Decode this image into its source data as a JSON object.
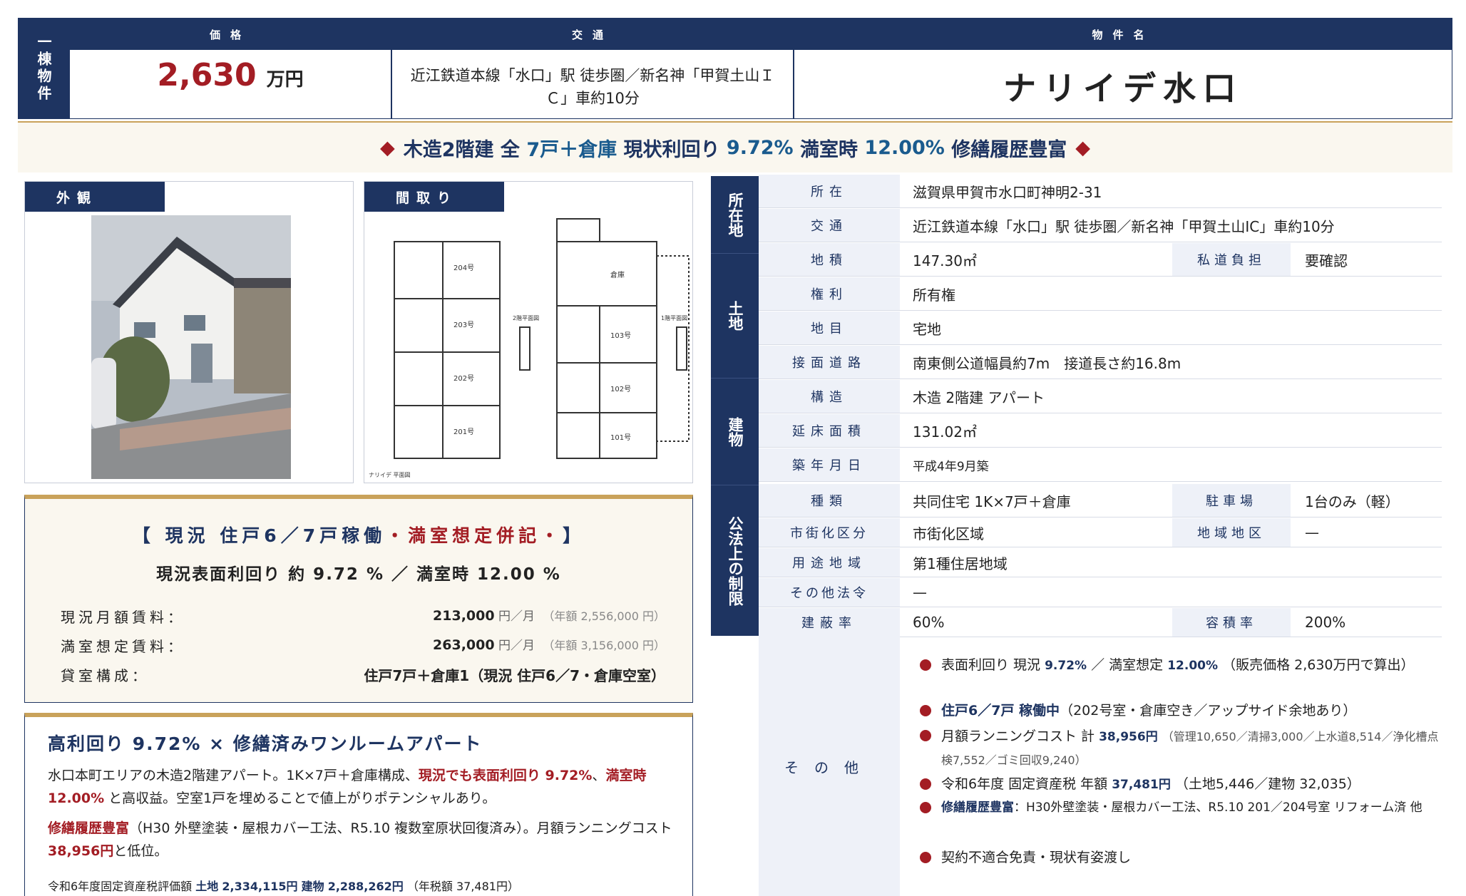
{
  "header": {
    "side_label": "一棟物件",
    "price_label": "価格",
    "price_value": "2,630",
    "price_unit": "万円",
    "transport_label": "交通",
    "transport_value": "近江鉄道本線「水口」駅 徒歩圏／新名神「甲賀土山ＩＣ」車約10分",
    "name_label": "物件名",
    "name_value": "ナリイデ水口"
  },
  "banner": {
    "diamond": "◆",
    "pre": "木造2階建 全",
    "hl1": "7戸＋倉庫",
    "mid": "現状利回り",
    "hl2": "9.72%",
    "mid2": "満室時",
    "hl3": "12.00%",
    "post": "修繕履歴豊富"
  },
  "photos": {
    "exterior_label": "外観",
    "floorplan_label": "間取り",
    "floorplan_rooms": [
      "204号",
      "203号",
      "202号",
      "201号",
      "倉庫",
      "103号",
      "102号",
      "101号"
    ],
    "floorplan_side_labels": [
      "2階平面図",
      "1階平面図"
    ],
    "floorplan_caption": "ナリイデ 平面図"
  },
  "income": {
    "title_open": "【",
    "title_main": "現況 住戸6／7戸稼働",
    "title_red": "・満室想定併記・",
    "title_close": "】",
    "subtitle": "現況表面利回り 約 9.72 % ／ 満室時 12.00 %",
    "rows": [
      {
        "label": "現況月額賃料：",
        "amount": "213,000",
        "unit": "円／月",
        "note": "（年額 2,556,000 円）"
      },
      {
        "label": "満室想定賃料：",
        "amount": "263,000",
        "unit": "円／月",
        "note": "（年額 3,156,000 円）"
      },
      {
        "label": "貸室構成：",
        "amount": "住戸7戸＋倉庫1（現況 住戸6／7・倉庫空室）",
        "unit": "",
        "note": ""
      }
    ]
  },
  "feature": {
    "title": "高利回り 9.72% × 修繕済みワンルームアパート",
    "p1_a": "水口本町エリアの木造2階建アパート。1K×7戸＋倉庫構成、",
    "p1_red1": "現況でも表面利回り 9.72%",
    "p1_b": "、",
    "p1_red2": "満室時",
    "p1_red3": "12.00%",
    "p1_c": " と高収益。空室1戸を埋めることで値上がりポテンシャルあり。",
    "p2_red": "修繕履歴豊富",
    "p2_a": "（H30 外壁塗装・屋根カバー工法、R5.10 複数室原状回復済み）。月額ランニングコスト",
    "p2_red2": "38,956円",
    "p2_b": "と低位。",
    "tax_a": "令和6年度固定資産税評価額",
    "tax_land_label": "土地",
    "tax_land": "2,334,115円",
    "tax_bldg_label": "建物",
    "tax_bldg": "2,288,262円",
    "tax_b": "（年税額 37,481円）"
  },
  "details": {
    "sections": [
      "所在地",
      "土地",
      "建物",
      "公法上の制限",
      "その他"
    ],
    "rows": [
      {
        "label": "所在",
        "value": "滋賀県甲賀市水口町神明2-31"
      },
      {
        "label": "交通",
        "value": "近江鉄道本線「水口」駅 徒歩圏／新名神「甲賀土山IC」車約10分"
      },
      {
        "label": "地積",
        "value": "147.30㎡",
        "label2": "私道負担",
        "value2": "要確認"
      },
      {
        "label": "権利",
        "value": "所有権"
      },
      {
        "label": "地目",
        "value": "宅地"
      },
      {
        "label": "接面道路",
        "value": "南東側公道幅員約7m　接道長さ約16.8m"
      },
      {
        "label": "構造",
        "value": "木造 2階建 アパート"
      },
      {
        "label": "延床面積",
        "value": "131.02㎡"
      },
      {
        "label": "築年月日",
        "value": "平成4年9月築"
      },
      {
        "label": "種類",
        "value": "共同住宅 1K×7戸＋倉庫",
        "label2": "駐車場",
        "value2": "1台のみ（軽）"
      },
      {
        "label": "市街化区分",
        "value": "市街化区域",
        "label2": "地域地区",
        "value2": "—"
      },
      {
        "label": "用途地域",
        "value": "第1種住居地域"
      },
      {
        "label": "その他法令",
        "value": "—"
      },
      {
        "label": "建蔽率",
        "value": "60%",
        "label2": "容積率",
        "value2": "200%"
      }
    ],
    "other_label": "その他",
    "bullets": {
      "b1_a": "表面利回り 現況",
      "b1_b": "9.72%",
      "b1_c": "／ 満室想定",
      "b1_d": "12.00%",
      "b1_e": "（販売価格 2,630万円で算出）",
      "b2_a": "住戸6／7戸 稼働中",
      "b2_b": "（202号室・倉庫空き／アップサイド余地あり）",
      "b3_a": "月額ランニングコスト 計",
      "b3_b": "38,956円",
      "b3_c": "（管理10,650／清掃3,000／上水道8,514／浄化槽点検7,552／ゴミ回収9,240）",
      "b4_a": "令和6年度 固定資産税 年額",
      "b4_b": "37,481円",
      "b4_c": "（土地5,446／建物 32,035）",
      "b5_a": "修繕履歴豊富",
      "b5_b": "：H30外壁塗装・屋根カバー工法、R5.10 201／204号室 リフォーム済 他",
      "b6": "契約不適合免責・現状有姿渡し"
    }
  },
  "colors": {
    "navy": "#1e3461",
    "red": "#a31d24",
    "cream": "#faf7ef",
    "gold": "#c9a25a"
  }
}
